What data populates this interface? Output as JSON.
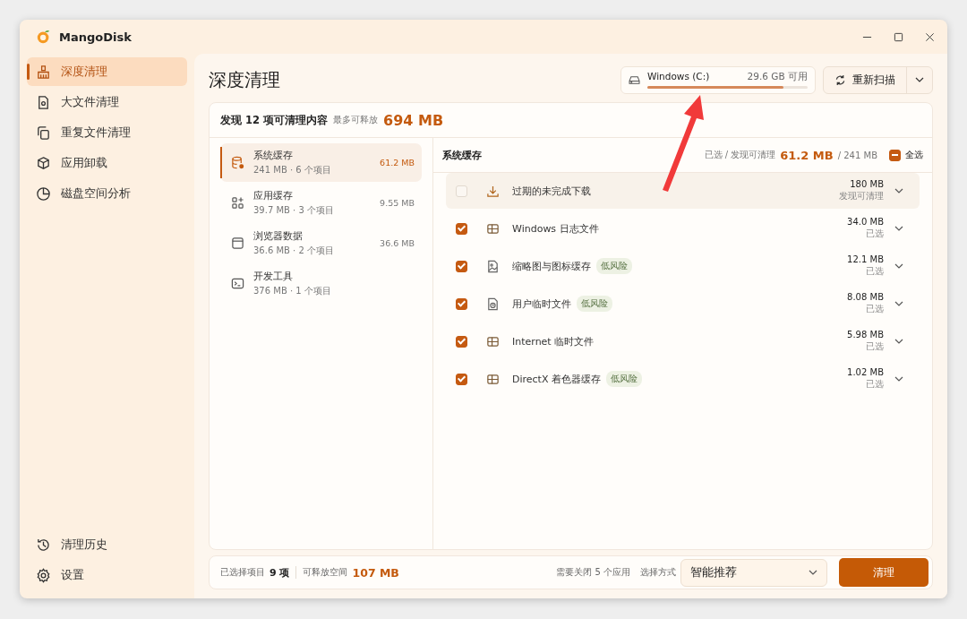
{
  "app": {
    "name": "MangoDisk"
  },
  "sidebar": {
    "items": [
      {
        "label": "深度清理",
        "kind": "broom",
        "selected": true
      },
      {
        "label": "大文件清理",
        "kind": "file-search",
        "selected": false
      },
      {
        "label": "重复文件清理",
        "kind": "copy",
        "selected": false
      },
      {
        "label": "应用卸载",
        "kind": "box",
        "selected": false
      },
      {
        "label": "磁盘空间分析",
        "kind": "pie",
        "selected": false
      }
    ],
    "bottom_items": [
      {
        "label": "清理历史",
        "kind": "history",
        "selected": false
      },
      {
        "label": "设置",
        "kind": "gear",
        "selected": false
      }
    ]
  },
  "page_title": "深度清理",
  "drive": {
    "name": "Windows (C:)",
    "free": "29.6 GB 可用",
    "level": 0.85
  },
  "rescan_button": "重新扫描",
  "summary": {
    "prefix": "发现 12 项可清理内容",
    "hint": "最多可释放",
    "total": "694 MB"
  },
  "categories": [
    {
      "name": "系统缓存",
      "detail": "241 MB · 6 个项目",
      "size": "61.2 MB",
      "kind": "database",
      "selected": true
    },
    {
      "name": "应用缓存",
      "detail": "39.7 MB · 3 个项目",
      "size": "9.55 MB",
      "kind": "apps",
      "selected": false
    },
    {
      "name": "浏览器数据",
      "detail": "36.6 MB · 2 个项目",
      "size": "36.6 MB",
      "kind": "browser",
      "selected": false
    },
    {
      "name": "开发工具",
      "detail": "376 MB · 1 个项目",
      "kind": "terminal",
      "selected": false
    }
  ],
  "detail": {
    "title": "系统缓存",
    "stat_label": "已选 / 发现可清理",
    "selected_size": "61.2 MB",
    "total_size": "/ 241 MB",
    "select_all": {
      "label": "全选",
      "indeterminate": true
    }
  },
  "entries": [
    {
      "name": "过期的未完成下载",
      "size": "180 MB",
      "status": "发现可清理",
      "kind": "download",
      "checked": false,
      "selected": true
    },
    {
      "name": "Windows 日志文件",
      "size": "34.0 MB",
      "status": "已选",
      "kind": "windows",
      "checked": true,
      "selected": false
    },
    {
      "name": "缩略图与图标缓存",
      "tag": "低风险",
      "size": "12.1 MB",
      "status": "已选",
      "kind": "image",
      "checked": true,
      "selected": false
    },
    {
      "name": "用户临时文件",
      "tag": "低风险",
      "size": "8.08 MB",
      "status": "已选",
      "kind": "temp",
      "checked": true,
      "selected": false
    },
    {
      "name": "Internet 临时文件",
      "size": "5.98 MB",
      "status": "已选",
      "kind": "windows",
      "checked": true,
      "selected": false
    },
    {
      "name": "DirectX 着色器缓存",
      "tag": "低风险",
      "size": "1.02 MB",
      "status": "已选",
      "kind": "windows",
      "checked": true,
      "selected": false
    }
  ],
  "footer": {
    "selected_label": "已选择项目",
    "selected_count": "9 项",
    "space_label": "可释放空间",
    "space": "107 MB",
    "note": "需要关闭 5 个应用",
    "mode_label": "选择方式",
    "mode": "智能推荐",
    "clean_button": "清理"
  }
}
